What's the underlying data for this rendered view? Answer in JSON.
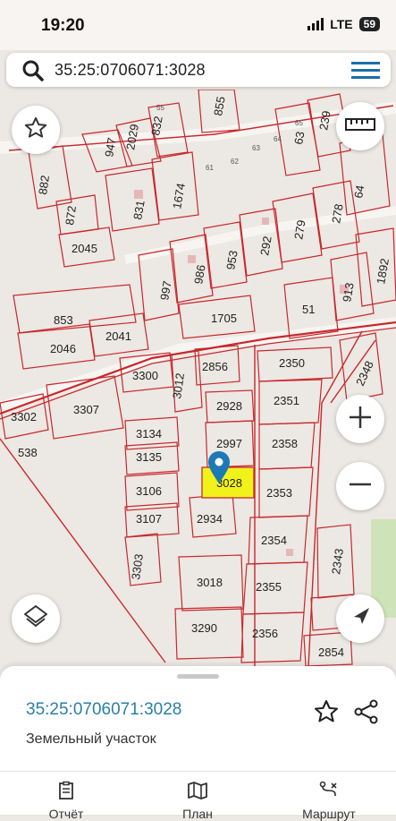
{
  "status": {
    "time": "19:20",
    "network": "LTE",
    "battery": "59"
  },
  "search": {
    "query": "35:25:0706071:3028"
  },
  "map": {
    "parcels": [
      "882",
      "872",
      "2045",
      "853",
      "2046",
      "2041",
      "3302",
      "538",
      "3307",
      "3300",
      "3012",
      "2856",
      "3134",
      "3135",
      "3106",
      "3107",
      "3303",
      "2928",
      "2997",
      "3028",
      "2934",
      "3018",
      "3290",
      "2350",
      "2351",
      "2358",
      "2353",
      "2354",
      "2355",
      "2356",
      "2343",
      "2854",
      "2348",
      "947",
      "2029",
      "832",
      "831",
      "1674",
      "855",
      "63",
      "239",
      "64",
      "278",
      "279",
      "292",
      "953",
      "986",
      "997",
      "1705",
      "51",
      "913",
      "1892"
    ],
    "small_labels": [
      "55",
      "61",
      "62",
      "63",
      "64",
      "65"
    ]
  },
  "parcel": {
    "cadastral_number": "35:25:0706071:3028",
    "type": "Земельный участок"
  },
  "tabs": [
    {
      "label": "Отчёт"
    },
    {
      "label": "План"
    },
    {
      "label": "Маршрут"
    }
  ],
  "colors": {
    "boundary": "#c8282d",
    "selected": "#f2f21b",
    "link": "#2a7fa7",
    "pin": "#1b79b6"
  }
}
